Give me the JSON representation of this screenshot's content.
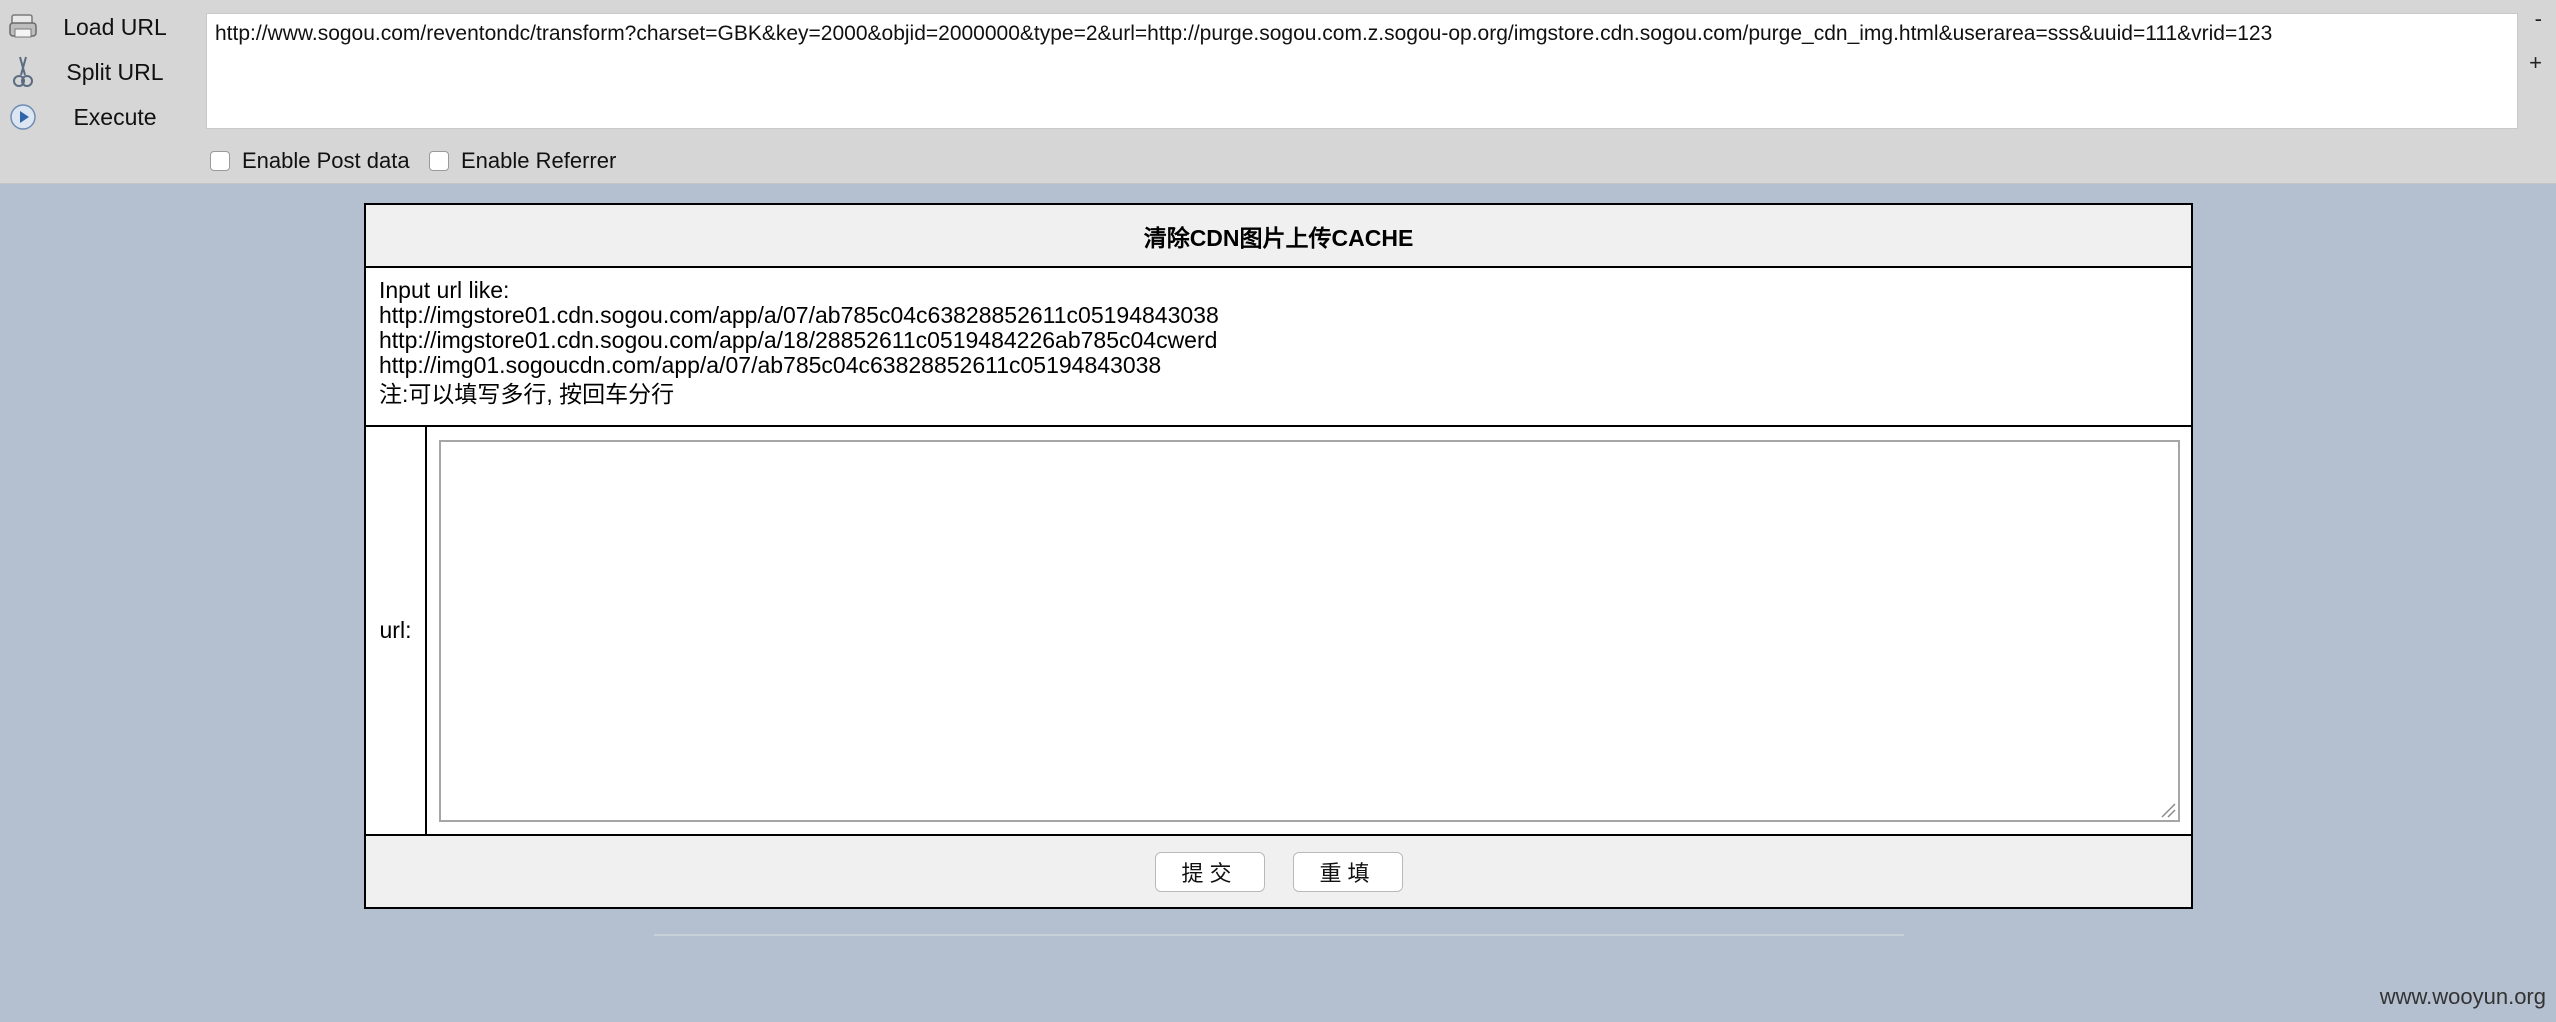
{
  "hackbar": {
    "load_url_label": "Load URL",
    "split_url_label": "Split URL",
    "execute_label": "Execute",
    "url_value": "http://www.sogou.com/reventondc/transform?charset=GBK&key=2000&objid=2000000&type=2&url=http://purge.sogou.com.z.sogou-op.org/imgstore.cdn.sogou.com/purge_cdn_img.html&userarea=sss&uuid=111&vrid=123",
    "shrink_label": "-",
    "grow_label": "+",
    "enable_post_label": "Enable Post data",
    "enable_referrer_label": "Enable Referrer",
    "enable_post_checked": false,
    "enable_referrer_checked": false
  },
  "form": {
    "title": "清除CDN图片上传CACHE",
    "info_heading": "Input url like:",
    "examples": [
      "http://imgstore01.cdn.sogou.com/app/a/07/ab785c04c63828852611c05194843038",
      "http://imgstore01.cdn.sogou.com/app/a/18/28852611c0519484226ab785c04cwerd",
      "http://img01.sogoucdn.com/app/a/07/ab785c04c63828852611c05194843038"
    ],
    "note": "注:可以填写多行, 按回车分行",
    "url_label": "url:",
    "url_value": "",
    "submit_label": "提交",
    "reset_label": "重填"
  },
  "footer": {
    "watermark": "www.wooyun.org"
  },
  "colors": {
    "page_background": "#b4c0cf",
    "toolbar_background": "#d6d6d6",
    "panel_header_background": "#f0f0f0"
  }
}
